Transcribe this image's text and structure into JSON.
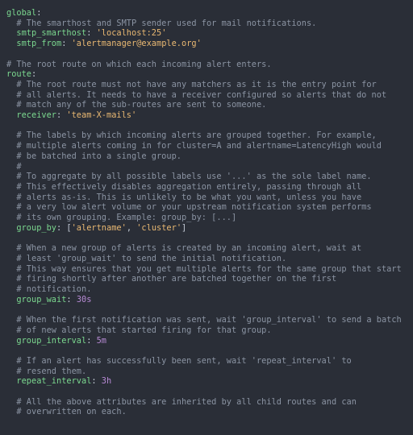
{
  "lines": [
    [
      [
        "k",
        "global"
      ],
      [
        "p",
        ":"
      ]
    ],
    [
      [
        "c",
        "  # The smarthost and SMTP sender used for mail notifications."
      ]
    ],
    [
      [
        "k",
        "  smtp_smarthost"
      ],
      [
        "p",
        ": "
      ],
      [
        "s",
        "'localhost:25'"
      ]
    ],
    [
      [
        "k",
        "  smtp_from"
      ],
      [
        "p",
        ": "
      ],
      [
        "s",
        "'alertmanager@example.org'"
      ]
    ],
    [
      [
        "p",
        ""
      ]
    ],
    [
      [
        "c",
        "# The root route on which each incoming alert enters."
      ]
    ],
    [
      [
        "k",
        "route"
      ],
      [
        "p",
        ":"
      ]
    ],
    [
      [
        "c",
        "  # The root route must not have any matchers as it is the entry point for"
      ]
    ],
    [
      [
        "c",
        "  # all alerts. It needs to have a receiver configured so alerts that do not"
      ]
    ],
    [
      [
        "c",
        "  # match any of the sub-routes are sent to someone."
      ]
    ],
    [
      [
        "k",
        "  receiver"
      ],
      [
        "p",
        ": "
      ],
      [
        "s",
        "'team-X-mails'"
      ]
    ],
    [
      [
        "p",
        ""
      ]
    ],
    [
      [
        "c",
        "  # The labels by which incoming alerts are grouped together. For example,"
      ]
    ],
    [
      [
        "c",
        "  # multiple alerts coming in for cluster=A and alertname=LatencyHigh would"
      ]
    ],
    [
      [
        "c",
        "  # be batched into a single group."
      ]
    ],
    [
      [
        "c",
        "  #"
      ]
    ],
    [
      [
        "c",
        "  # To aggregate by all possible labels use '...' as the sole label name."
      ]
    ],
    [
      [
        "c",
        "  # This effectively disables aggregation entirely, passing through all"
      ]
    ],
    [
      [
        "c",
        "  # alerts as-is. This is unlikely to be what you want, unless you have"
      ]
    ],
    [
      [
        "c",
        "  # a very low alert volume or your upstream notification system performs"
      ]
    ],
    [
      [
        "c",
        "  # its own grouping. Example: group_by: [...]"
      ]
    ],
    [
      [
        "k",
        "  group_by"
      ],
      [
        "p",
        ": ["
      ],
      [
        "s",
        "'alertname'"
      ],
      [
        "p",
        ", "
      ],
      [
        "s",
        "'cluster'"
      ],
      [
        "p",
        "]"
      ]
    ],
    [
      [
        "p",
        ""
      ]
    ],
    [
      [
        "c",
        "  # When a new group of alerts is created by an incoming alert, wait at"
      ]
    ],
    [
      [
        "c",
        "  # least 'group_wait' to send the initial notification."
      ]
    ],
    [
      [
        "c",
        "  # This way ensures that you get multiple alerts for the same group that start"
      ]
    ],
    [
      [
        "c",
        "  # firing shortly after another are batched together on the first"
      ]
    ],
    [
      [
        "c",
        "  # notification."
      ]
    ],
    [
      [
        "k",
        "  group_wait"
      ],
      [
        "p",
        ": "
      ],
      [
        "n",
        "30s"
      ]
    ],
    [
      [
        "p",
        ""
      ]
    ],
    [
      [
        "c",
        "  # When the first notification was sent, wait 'group_interval' to send a batch"
      ]
    ],
    [
      [
        "c",
        "  # of new alerts that started firing for that group."
      ]
    ],
    [
      [
        "k",
        "  group_interval"
      ],
      [
        "p",
        ": "
      ],
      [
        "n",
        "5m"
      ]
    ],
    [
      [
        "p",
        ""
      ]
    ],
    [
      [
        "c",
        "  # If an alert has successfully been sent, wait 'repeat_interval' to"
      ]
    ],
    [
      [
        "c",
        "  # resend them."
      ]
    ],
    [
      [
        "k",
        "  repeat_interval"
      ],
      [
        "p",
        ": "
      ],
      [
        "n",
        "3h"
      ]
    ],
    [
      [
        "p",
        ""
      ]
    ],
    [
      [
        "c",
        "  # All the above attributes are inherited by all child routes and can"
      ]
    ],
    [
      [
        "c",
        "  # overwritten on each."
      ]
    ]
  ]
}
